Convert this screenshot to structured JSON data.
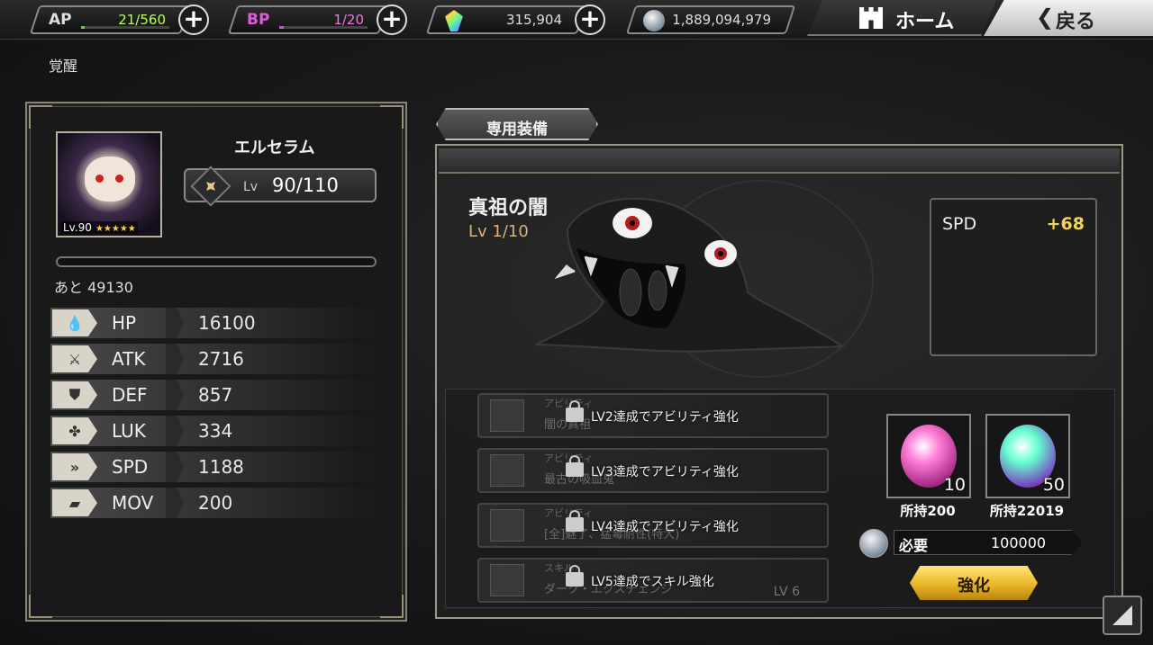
{
  "topbar": {
    "ap": {
      "label": "AP",
      "value": "21/560",
      "fill_fraction": 0.0375
    },
    "bp": {
      "label": "BP",
      "value": "1/20",
      "fill_fraction": 0.05
    },
    "crystals": {
      "value": "315,904"
    },
    "coins": {
      "value": "1,889,094,979"
    },
    "home_label": "ホーム",
    "back_label": "戻る"
  },
  "page_title": "覚醒",
  "character": {
    "name": "エルセラム",
    "avatar_lv": "Lv.90",
    "avatar_stars": "★★★★★",
    "lv_prefix": "Lv",
    "lv_text": "90/110",
    "exp_remaining": "あと 49130",
    "exp_fill_fraction": 0.0
  },
  "stats": [
    {
      "name": "HP",
      "value": "16100",
      "icon": "drop-icon"
    },
    {
      "name": "ATK",
      "value": "2716",
      "icon": "sword-icon"
    },
    {
      "name": "DEF",
      "value": "857",
      "icon": "shield-icon"
    },
    {
      "name": "LUK",
      "value": "334",
      "icon": "clover-icon"
    },
    {
      "name": "SPD",
      "value": "1188",
      "icon": "speed-icon"
    },
    {
      "name": "MOV",
      "value": "200",
      "icon": "boot-icon"
    }
  ],
  "equipment": {
    "tab_label": "専用装備",
    "name": "真祖の闇",
    "lv": "Lv  1/10",
    "bonus_stat": "SPD",
    "bonus_value": "+68"
  },
  "abilities": [
    {
      "category": "アビリティ",
      "name": "闇の真祖",
      "lock_msg": "LV2達成でアビリティ強化",
      "level": ""
    },
    {
      "category": "アビリティ",
      "name": "最古の吸血鬼",
      "lock_msg": "LV3達成でアビリティ強化",
      "level": ""
    },
    {
      "category": "アビリティ",
      "name": "[全]魅了、猛毒耐性(特大)",
      "lock_msg": "LV4達成でアビリティ強化",
      "level": ""
    },
    {
      "category": "スキル",
      "name": "ダーク・エクスチェンジ",
      "lock_msg": "LV5達成でスキル強化",
      "level": "LV 6"
    }
  ],
  "materials": [
    {
      "count": "10",
      "owned": "所持200",
      "color_a": "#ff7ed6",
      "color_b": "#9b1e7e"
    },
    {
      "count": "50",
      "owned": "所持22019",
      "color_a": "#66ffd0",
      "color_b": "#7a2bbf"
    }
  ],
  "cost": {
    "label": "必要",
    "value": "100000"
  },
  "enhance_label": "強化"
}
